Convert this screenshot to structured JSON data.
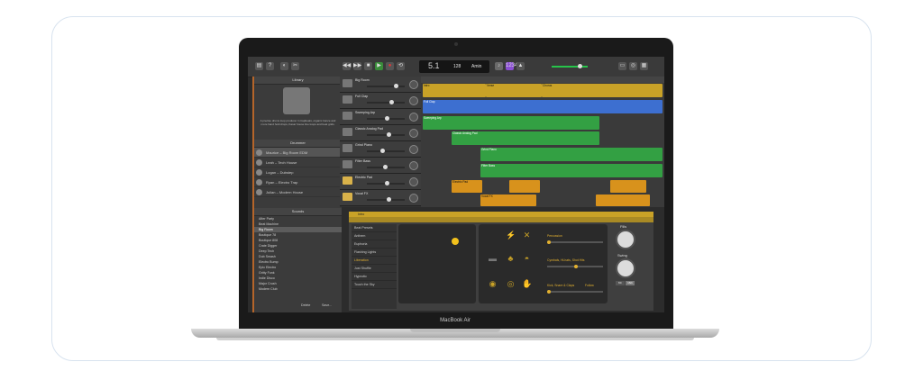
{
  "device": {
    "label": "MacBook Air"
  },
  "transport": {
    "position": "5.1",
    "tempo": "128",
    "key": "Amin"
  },
  "library": {
    "title": "Library",
    "description": "A precise drums loop producer in trapbeats, organic trance and more hand hold drops, Kasar house line loops and beat grids.",
    "drummer_header": "Drummer",
    "drummers": [
      {
        "name": "Maurice – Big Room EDM",
        "selected": true
      },
      {
        "name": "Leah – Tech House",
        "selected": false
      },
      {
        "name": "Logan – Dubstep",
        "selected": false
      },
      {
        "name": "Ryan – Electro Trap",
        "selected": false
      },
      {
        "name": "Julian – Modern House",
        "selected": false
      }
    ],
    "sounds_header": "Sounds",
    "sounds": [
      "After Party",
      "Beat Machine",
      "Big Room",
      "Boutique 78",
      "Boutique 808",
      "Crate Digger",
      "Deep Tech",
      "Dub Smash",
      "Electro Bump",
      "Epic Electro",
      "Gritty Funk",
      "Indie Disco",
      "Major Crush",
      "Modern Club"
    ],
    "selected_sound": "Big Room",
    "footer_left": "Delete",
    "footer_right": "Save..."
  },
  "tracks": [
    {
      "name": "Big Room"
    },
    {
      "name": "Full Clap"
    },
    {
      "name": "Sweeping Arp"
    },
    {
      "name": "Classic Analog Pad"
    },
    {
      "name": "Grind Piano"
    },
    {
      "name": "Filter Bass"
    },
    {
      "name": "Electric Pad"
    },
    {
      "name": "Vocal FX"
    }
  ],
  "regions": [
    {
      "label": "Intro"
    },
    {
      "label": "Verse"
    },
    {
      "label": "Chorus"
    },
    {
      "label": "Full Clap"
    },
    {
      "label": "Sweeping Arp"
    },
    {
      "label": "Classic Analog Pad"
    },
    {
      "label": "Grind Piano"
    },
    {
      "label": "Filter Bass"
    },
    {
      "label": "Electric Pad"
    },
    {
      "label": "Vocal FX"
    }
  ],
  "editor": {
    "title": "Intro",
    "presets": [
      "Beat Presets",
      "Anthem",
      "Euphoria",
      "Flashing Lights",
      "Liberation",
      "Just Shuffle",
      "Hypnotic",
      "Touch the Sky"
    ],
    "selected_preset": "Liberation",
    "kit_labels": [
      "Percussion",
      "Cymbals, Hi-hats, Shot Hits",
      "Kick, Snare & Claps",
      "Follow"
    ],
    "fills_label": "Fills",
    "swing_label": "Swing",
    "swing_buttons": [
      "8th",
      "16th"
    ]
  },
  "colors": {
    "accent": "#c9a227",
    "track_green": "#33a043",
    "audio_blue": "#3d6fd0",
    "region_orange": "#d8921c",
    "library_edge": "#b5652a"
  }
}
